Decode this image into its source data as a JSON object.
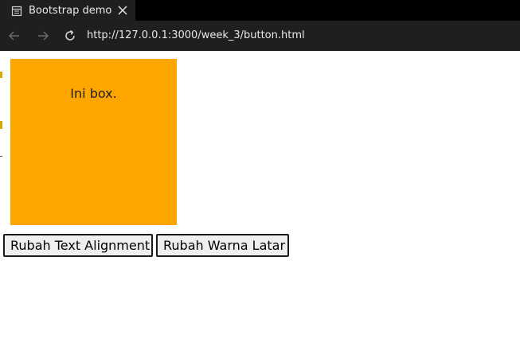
{
  "browser": {
    "tab_title": "Bootstrap demo",
    "url": "http://127.0.0.1:3000/week_3/button.html",
    "icons": {
      "tab": "page-icon",
      "close": "close-icon",
      "back": "back-arrow-icon",
      "forward": "forward-arrow-icon",
      "reload": "reload-icon"
    }
  },
  "page": {
    "box_text": "Ini box.",
    "box_color": "#ffa500",
    "buttons": {
      "align_label": "Rubah Text Alignment",
      "color_label": "Rubah Warna Latar"
    }
  }
}
